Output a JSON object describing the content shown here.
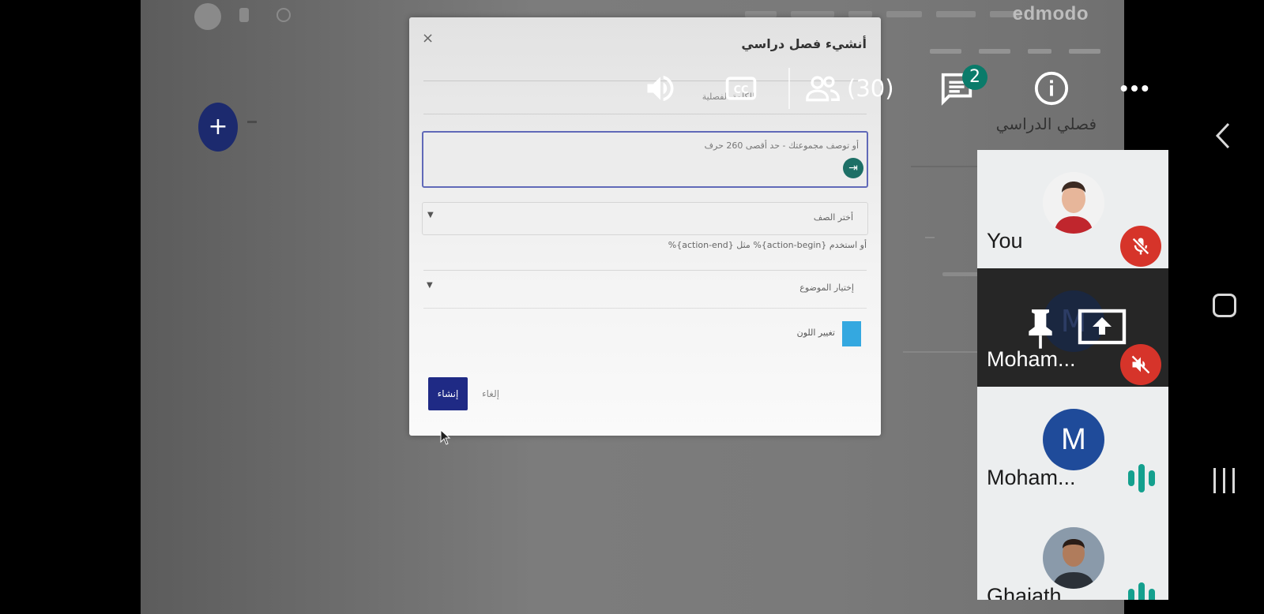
{
  "shared_screen": {
    "brand": "edmodo",
    "classes_title": "فصلي الدراسي"
  },
  "modal": {
    "title": "أنشيء فصل دراسي",
    "close_label": "×",
    "name_label": "الكلمة الفصلية",
    "description_placeholder": "أو توصف مجموعتك - حد أقصى 260 حرف",
    "grade_select": "أختر الصف",
    "hint": "أو استخدم {action-begin}% مثل {action-end}%",
    "subject_select": "إختيار الموضوع",
    "color_label": "تغيير اللون",
    "create_button": "إنشاء",
    "cancel_button": "إلغاء",
    "swatch_color": "#34a8e0"
  },
  "toolbar": {
    "participants_count": "(30)",
    "chat_badge": "2"
  },
  "participants": [
    {
      "name": "You",
      "muted": true,
      "avatar": "photo"
    },
    {
      "name": "Moham...",
      "muted": true,
      "avatar": "M",
      "pinned": true,
      "sharing": true
    },
    {
      "name": "Moham...",
      "muted": false,
      "avatar": "M",
      "speaking": true
    },
    {
      "name": "Ghaiath...",
      "muted": false,
      "avatar": "photo",
      "speaking": true
    }
  ],
  "colors": {
    "accent_blue": "#1f2a85",
    "mute_red": "#d6342a",
    "badge_green": "#0a7b6a",
    "talk_teal": "#14a08e",
    "avatar_blue": "#1f4b9a"
  }
}
